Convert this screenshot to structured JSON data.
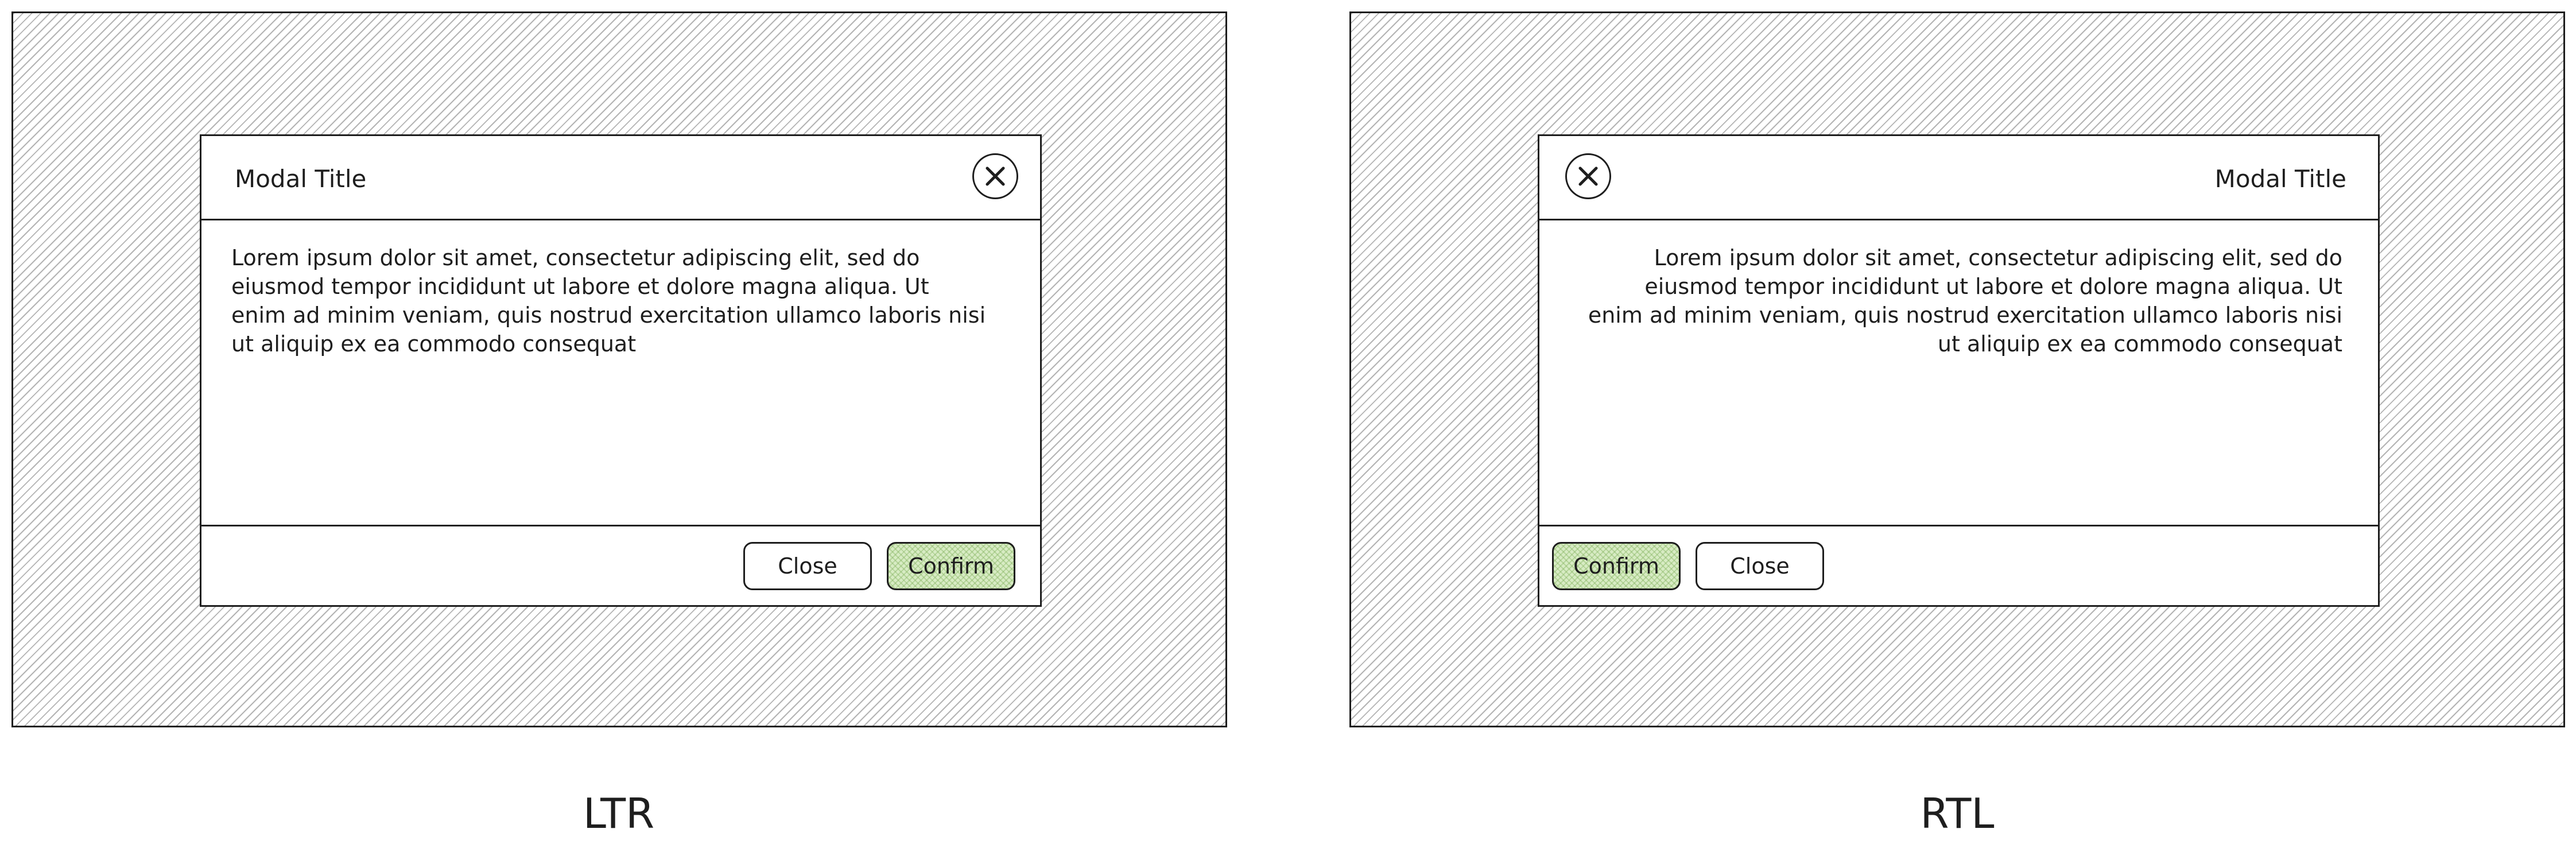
{
  "ltr": {
    "modal": {
      "title": "Modal Title",
      "body_lines": [
        "Lorem ipsum dolor sit amet, consectetur adipiscing elit, sed do",
        "eiusmod tempor incididunt ut labore et dolore magna aliqua. Ut",
        "enim ad minim veniam, quis nostrud exercitation ullamco laboris nisi",
        "ut aliquip ex ea commodo consequat"
      ],
      "close_label": "Close",
      "confirm_label": "Confirm"
    },
    "caption": "LTR"
  },
  "rtl": {
    "modal": {
      "title": "Modal Title",
      "body_lines": [
        "Lorem ipsum dolor sit amet, consectetur adipiscing elit, sed do",
        "eiusmod tempor incididunt ut labore et dolore magna aliqua. Ut",
        "enim ad minim veniam, quis nostrud exercitation ullamco laboris nisi",
        "ut aliquip ex ea commodo consequat"
      ],
      "close_label": "Close",
      "confirm_label": "Confirm"
    },
    "caption": "RTL"
  },
  "icons": {
    "close": "close-x-icon"
  },
  "colors": {
    "confirm_fill": "#d8ecc4",
    "stroke": "#1e1e1e",
    "backdrop_hatch": "#b4b4b4"
  }
}
